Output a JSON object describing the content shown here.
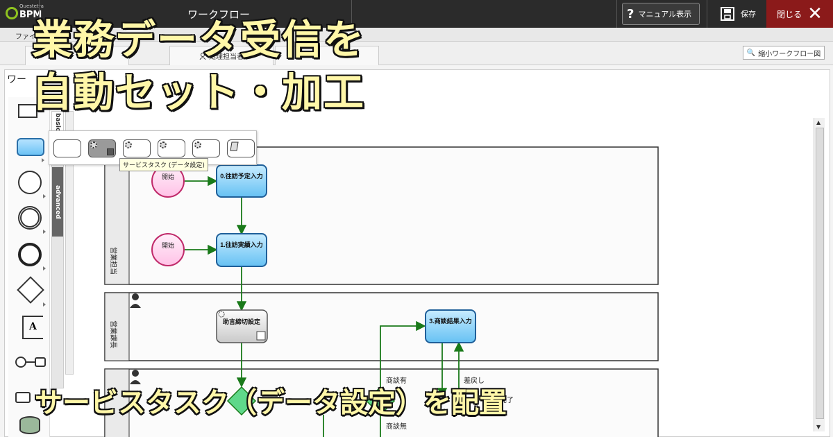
{
  "topbar": {
    "brand": "BPM",
    "brand_small": "Questetra",
    "title": "ワークフロー",
    "manual_button": "マニュアル表示",
    "save_button": "保存",
    "close_button": "閉じる"
  },
  "menubar": {
    "file_menu": "ファイル"
  },
  "tabs": [
    {
      "label": ""
    },
    {
      "label": "処理担当者"
    },
    {
      "label": ""
    }
  ],
  "mini_workflow_button": "縮小ワークフロー図",
  "canvas_title": "ワー",
  "palette": {
    "tab_basic": "basic",
    "tab_advanced": "advanced"
  },
  "flyout": {
    "tooltip": "サービスタスク (データ設定)"
  },
  "diagram": {
    "lane1_label": "営業担当",
    "lane2_label": "営業課長",
    "start1": "開始",
    "start2": "開始",
    "task0": "0.往訪予定入力",
    "task1": "1.往訪実績入力",
    "service_task": "助言締切設定",
    "task3": "3.商談結果入力",
    "label_yes": "商談有",
    "label_no": "商談無",
    "label_back": "差戻し",
    "label_done": "完了"
  },
  "overlay": {
    "title_line1": "業務データ受信を",
    "title_line2": "自動セット・加工",
    "subtitle": "サービスタスク（データ設定）を配置"
  },
  "colors": {
    "topbar": "#2b2b2b",
    "close": "#8b1a1a",
    "task_fill": "#8fd3fb",
    "task_border": "#1f5f99",
    "start_fill": "#ffd6f0",
    "start_border": "#c02a6a",
    "arrow": "#1a7a1a",
    "gateway": "#5fd88a",
    "overlay_text": "#fff7a8"
  }
}
